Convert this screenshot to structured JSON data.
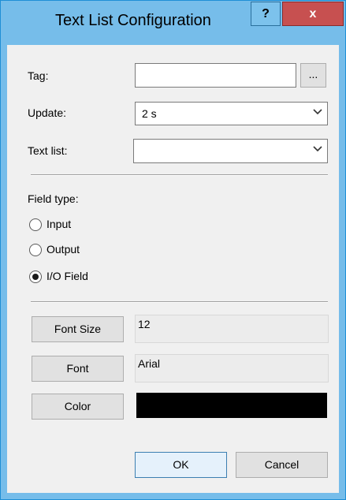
{
  "window": {
    "title": "Text List Configuration",
    "help_label": "?",
    "close_label": "x"
  },
  "form": {
    "tag_label": "Tag:",
    "tag_value": "",
    "browse_label": "...",
    "update_label": "Update:",
    "update_value": "2 s",
    "textlist_label": "Text list:",
    "textlist_value": ""
  },
  "field_type": {
    "heading": "Field type:",
    "options": [
      {
        "label": "Input",
        "selected": false
      },
      {
        "label": "Output",
        "selected": false
      },
      {
        "label": "I/O Field",
        "selected": true
      }
    ]
  },
  "appearance": {
    "font_size_button": "Font Size",
    "font_size_value": "12",
    "font_button": "Font",
    "font_value": "Arial",
    "color_button": "Color",
    "color_value": "#000000"
  },
  "buttons": {
    "ok": "OK",
    "cancel": "Cancel"
  }
}
